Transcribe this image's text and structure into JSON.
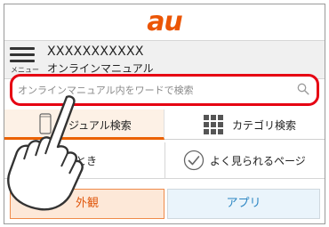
{
  "brand": {
    "logo_text": "au",
    "color": "#eb5505"
  },
  "header": {
    "menu_label": "メニュー",
    "title_line1": "XXXXXXXXXXX",
    "title_line2": "オンラインマニュアル"
  },
  "search": {
    "placeholder": "オンラインマニュアル内をワードで検索",
    "icon": "search-icon",
    "highlight_color": "#e60012"
  },
  "tabs": [
    {
      "label": "ジュアル検索",
      "icon": "phone-icon",
      "active": true
    },
    {
      "label": "カテゴリ検索",
      "icon": "grid-icon",
      "active": false
    }
  ],
  "quick_links": [
    {
      "label": "たとき"
    },
    {
      "label": "よく見られるページ",
      "icon": "check-circle-icon"
    }
  ],
  "bottom_tabs": [
    {
      "label": "外観",
      "active": true
    },
    {
      "label": "アプリ",
      "active": false
    }
  ],
  "overlay": {
    "icon": "pointing-hand-icon"
  }
}
